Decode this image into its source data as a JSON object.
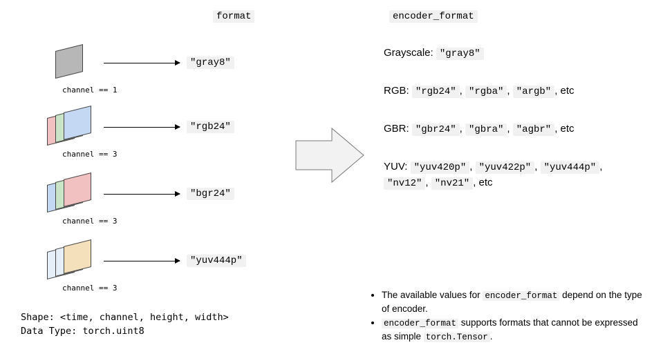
{
  "headers": {
    "format": "format",
    "encoder_format": "encoder_format"
  },
  "rows": [
    {
      "channel_label": "channel == 1",
      "format": "\"gray8\""
    },
    {
      "channel_label": "channel == 3",
      "format": "\"rgb24\""
    },
    {
      "channel_label": "channel == 3",
      "format": "\"bgr24\""
    },
    {
      "channel_label": "channel == 3",
      "format": "\"yuv444p\""
    }
  ],
  "right": {
    "grayscale_label": "Grayscale: ",
    "grayscale_vals": [
      "\"gray8\""
    ],
    "rgb_label": "RGB: ",
    "rgb_vals": [
      "\"rgb24\"",
      "\"rgba\"",
      "\"argb\""
    ],
    "gbr_label": "GBR: ",
    "gbr_vals": [
      "\"gbr24\"",
      "\"gbra\"",
      "\"agbr\""
    ],
    "yuv_label": "YUV: ",
    "yuv_vals": [
      "\"yuv420p\"",
      "\"yuv422p\"",
      "\"yuv444p\"",
      "\"nv12\"",
      "\"nv21\""
    ],
    "etc": ", etc"
  },
  "footer": {
    "shape_label": "Shape: ",
    "shape_value": "<time, channel, height, width>",
    "dtype_label": "Data Type: ",
    "dtype_value": "torch.uint8"
  },
  "bullets": {
    "b1_pre": "The available values for ",
    "b1_code": "encoder_format",
    "b1_post": " depend on the type of encoder.",
    "b2_code1": "encoder_format",
    "b2_mid": " supports formats that cannot be expressed as simple ",
    "b2_code2": "torch.Tensor",
    "b2_post": "."
  }
}
